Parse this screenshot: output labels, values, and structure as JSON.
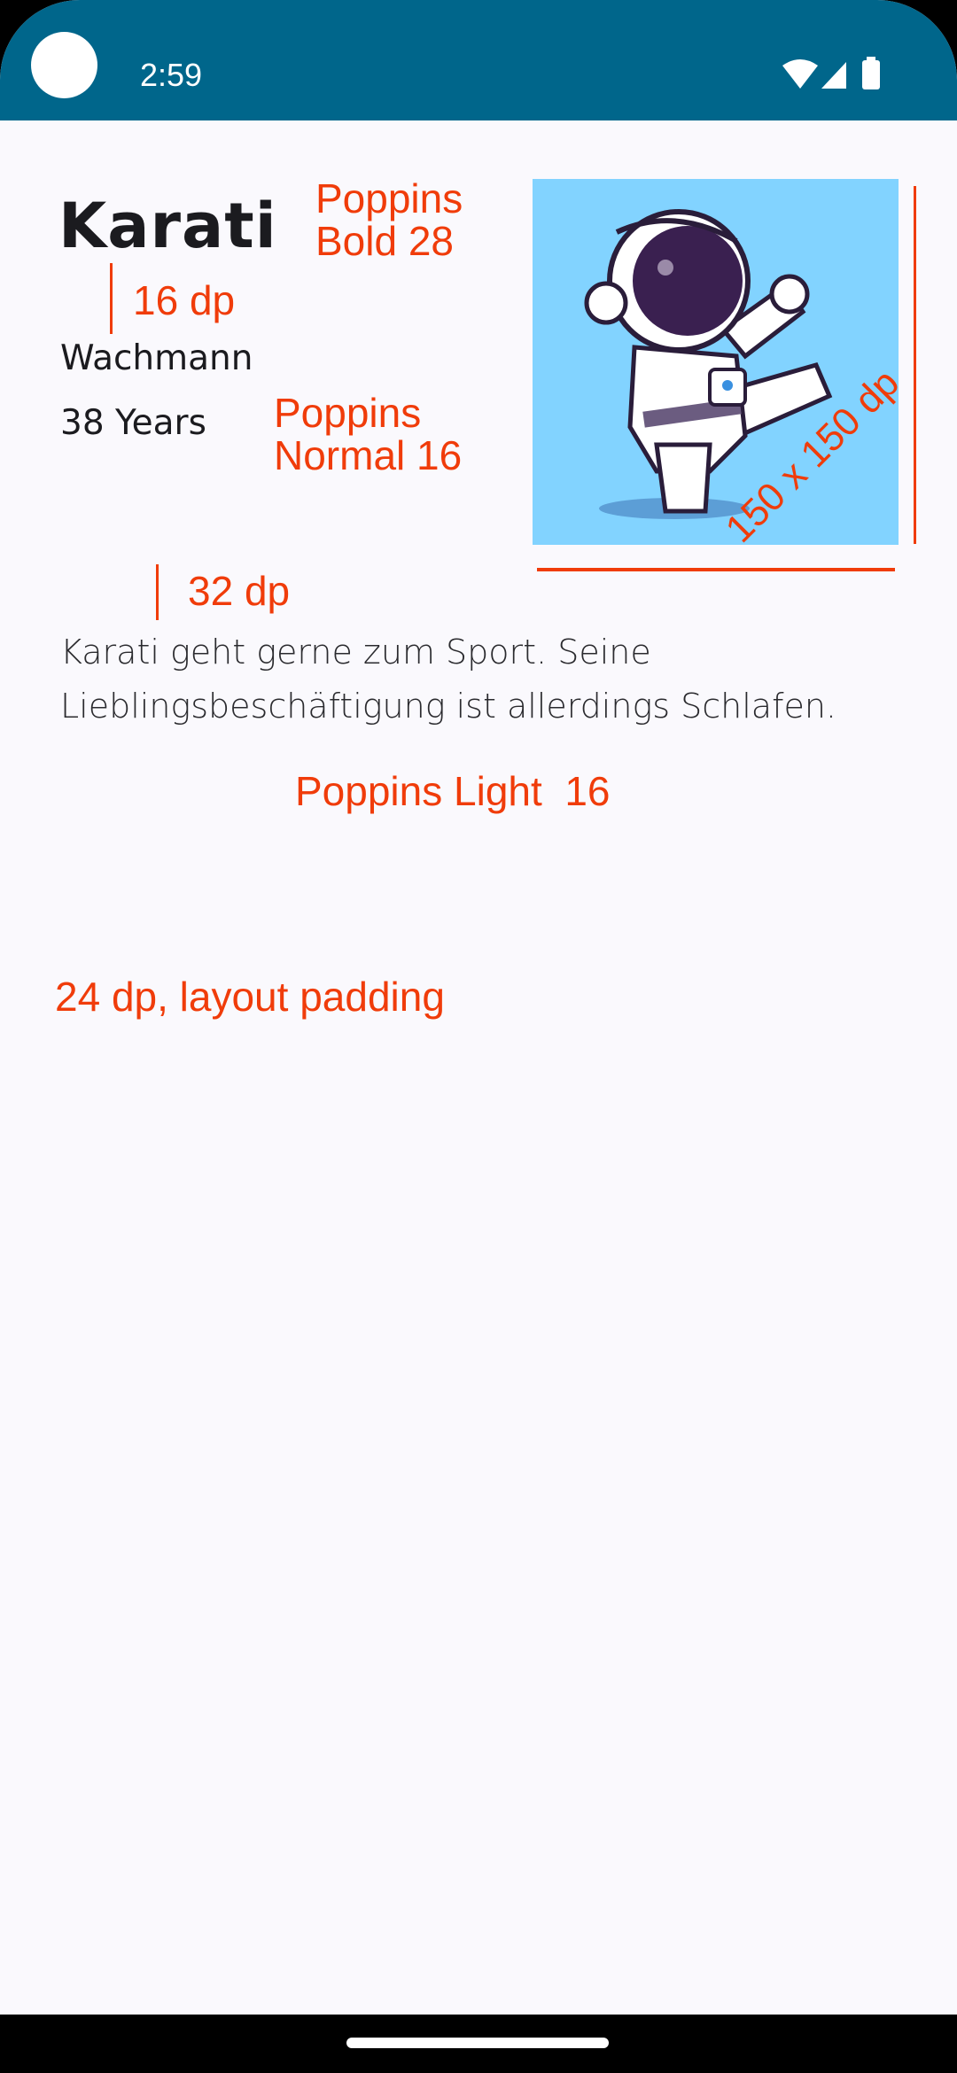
{
  "status_bar": {
    "time": "2:59",
    "icons": [
      "wifi-icon",
      "signal-icon",
      "battery-icon"
    ],
    "color": "#00668B"
  },
  "profile": {
    "name": "Karati",
    "job": "Wachmann",
    "age": "38 Years",
    "description": "Karati geht gerne zum Sport. Seine Lieblingsbeschäftigung ist allerdings Schlafen.",
    "image": "karate-astronaut-illustration"
  },
  "annotations": {
    "title_font_line1": "Poppins",
    "title_font_line2": "Bold 28",
    "spacing_16": "16 dp",
    "normal_font_line1": "Poppins",
    "normal_font_line2": "Normal 16",
    "image_size": "150 x 150 dp",
    "spacing_32": "32 dp",
    "light_font": "Poppins Light  16",
    "padding": "24 dp, layout padding",
    "color": "#F03C0A"
  }
}
